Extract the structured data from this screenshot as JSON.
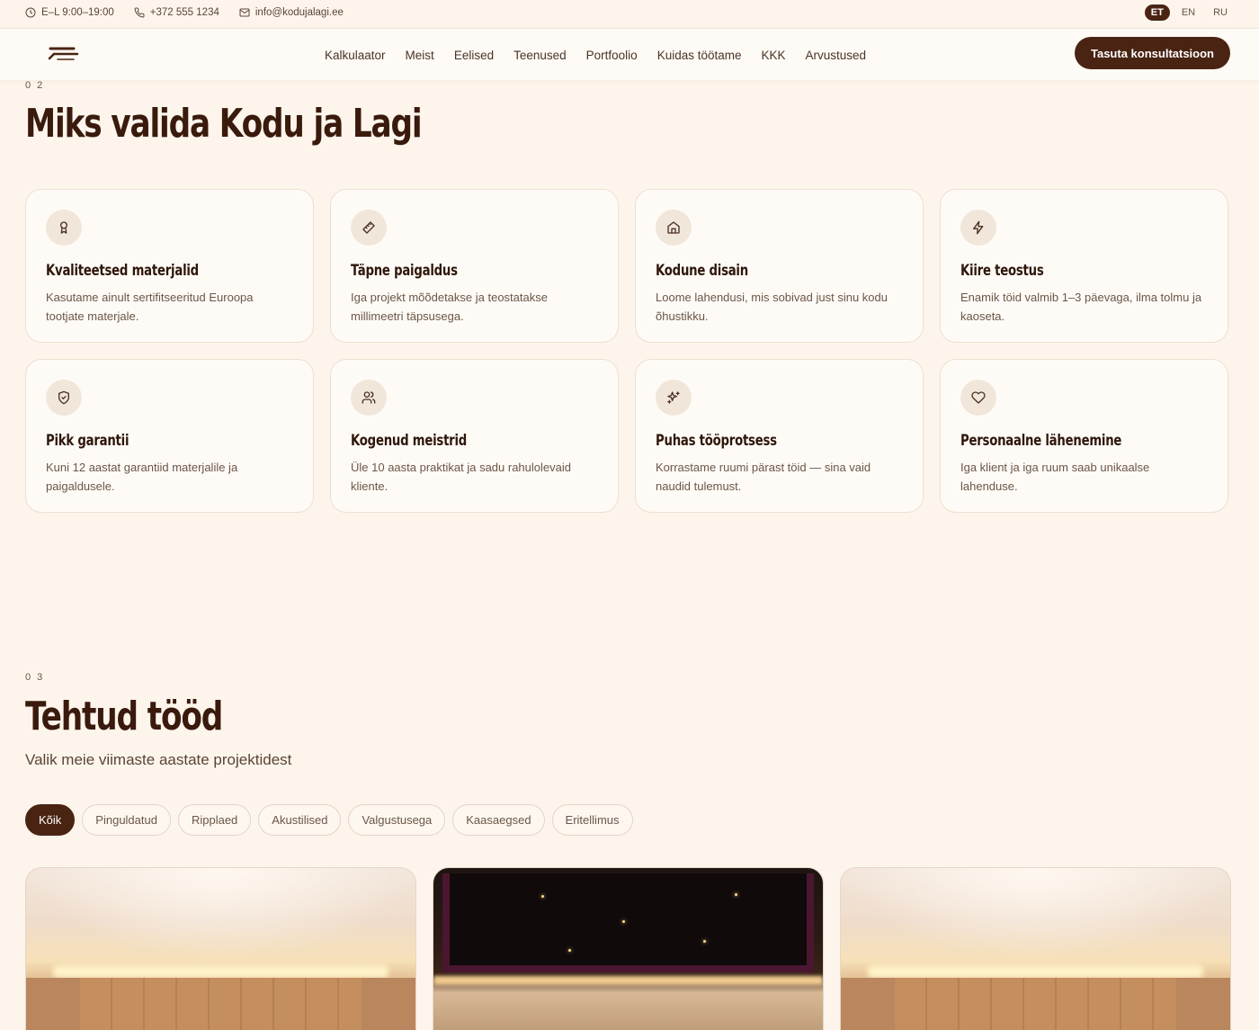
{
  "topbar": {
    "hours": "E–L 9:00–19:00",
    "phone": "+372 555 1234",
    "email": "info@kodujalagi.ee",
    "languages": [
      "ET",
      "EN",
      "RU"
    ],
    "active_language": "ET"
  },
  "nav": {
    "items": [
      "Kalkulaator",
      "Meist",
      "Eelised",
      "Teenused",
      "Portfoolio",
      "Kuidas töötame",
      "KKK",
      "Arvustused"
    ],
    "cta": "Tasuta konsultatsioon"
  },
  "why": {
    "number": "0 2",
    "title": "Miks valida Kodu ja Lagi",
    "cards": [
      {
        "icon": "award-icon",
        "title": "Kvaliteetsed materjalid",
        "text": "Kasutame ainult sertifitseeritud Euroopa tootjate materjale."
      },
      {
        "icon": "ruler-icon",
        "title": "Täpne paigaldus",
        "text": "Iga projekt mõõdetakse ja teostatakse millimeetri täpsusega."
      },
      {
        "icon": "home-icon",
        "title": "Kodune disain",
        "text": "Loome lahendusi, mis sobivad just sinu kodu õhustikku."
      },
      {
        "icon": "zap-icon",
        "title": "Kiire teostus",
        "text": "Enamik töid valmib 1–3 päevaga, ilma tolmu ja kaoseta."
      },
      {
        "icon": "shield-check-icon",
        "title": "Pikk garantii",
        "text": "Kuni 12 aastat garantiid materjalile ja paigaldusele."
      },
      {
        "icon": "users-icon",
        "title": "Kogenud meistrid",
        "text": "Üle 10 aasta praktikat ja sadu rahulolevaid kliente."
      },
      {
        "icon": "sparkles-icon",
        "title": "Puhas tööprotsess",
        "text": "Korrastame ruumi pärast töid — sina vaid naudid tulemust."
      },
      {
        "icon": "heart-icon",
        "title": "Personaalne lähenemine",
        "text": "Iga klient ja iga ruum saab unikaalse lahenduse."
      }
    ]
  },
  "works": {
    "number": "0 3",
    "title": "Tehtud tööd",
    "subtitle": "Valik meie viimaste aastate projektidest",
    "filters": [
      "Kõik",
      "Pinguldatud",
      "Ripplaed",
      "Akustilised",
      "Valgustusega",
      "Kaasaegsed",
      "Eritellimus"
    ],
    "active_filter": "Kõik"
  }
}
